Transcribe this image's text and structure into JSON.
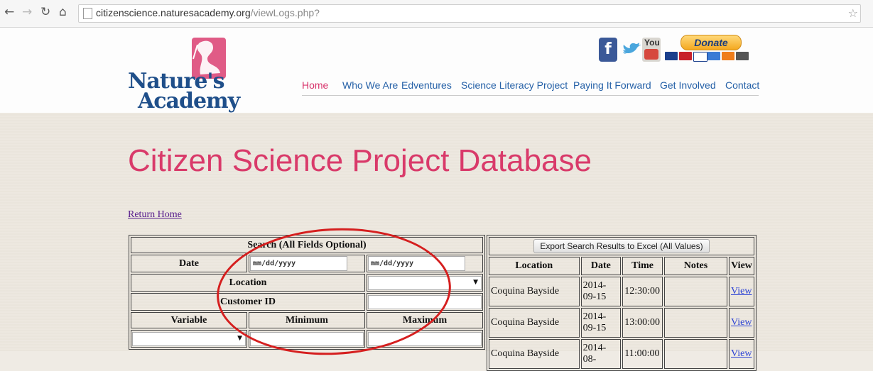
{
  "browser": {
    "url_host": "citizenscience.naturesacademy.org",
    "url_path": "/viewLogs.php?"
  },
  "logo": {
    "line1": "Nature's",
    "line2": "Academy"
  },
  "social": {
    "facebook": "f",
    "youtube": "You"
  },
  "donate": {
    "label": "Donate"
  },
  "menu": [
    {
      "label": "Home"
    },
    {
      "label": "Who We Are"
    },
    {
      "label": "Edventures"
    },
    {
      "label": "Science Literacy Project"
    },
    {
      "label": "Paying It Forward"
    },
    {
      "label": "Get Involved"
    },
    {
      "label": "Contact"
    }
  ],
  "page": {
    "title": "Citizen Science Project Database",
    "return_link": "Return Home"
  },
  "search": {
    "header": "Search (All Fields Optional)",
    "date_label": "Date",
    "date_from_placeholder": "mm/dd/yyyy",
    "date_to_placeholder": "mm/dd/yyyy",
    "location_label": "Location",
    "customer_label": "Customer ID",
    "variable_label": "Variable",
    "minimum_label": "Minimum",
    "maximum_label": "Maximum"
  },
  "results": {
    "export_label": "Export Search Results to Excel (All Values)",
    "columns": [
      "Location",
      "Date",
      "Time",
      "Notes",
      "View"
    ],
    "rows": [
      {
        "location": "Coquina Bayside",
        "date": "2014-09-15",
        "time": "12:30:00",
        "notes": "",
        "view": "View"
      },
      {
        "location": "Coquina Bayside",
        "date": "2014-09-15",
        "time": "13:00:00",
        "notes": "",
        "view": "View"
      },
      {
        "location": "Coquina Bayside",
        "date": "2014-08-",
        "time": "11:00:00",
        "notes": "",
        "view": "View"
      }
    ]
  },
  "colors": {
    "title_pink": "#d93a6a",
    "link_blue": "#2460a7",
    "annotation_red": "#d51f1f"
  }
}
